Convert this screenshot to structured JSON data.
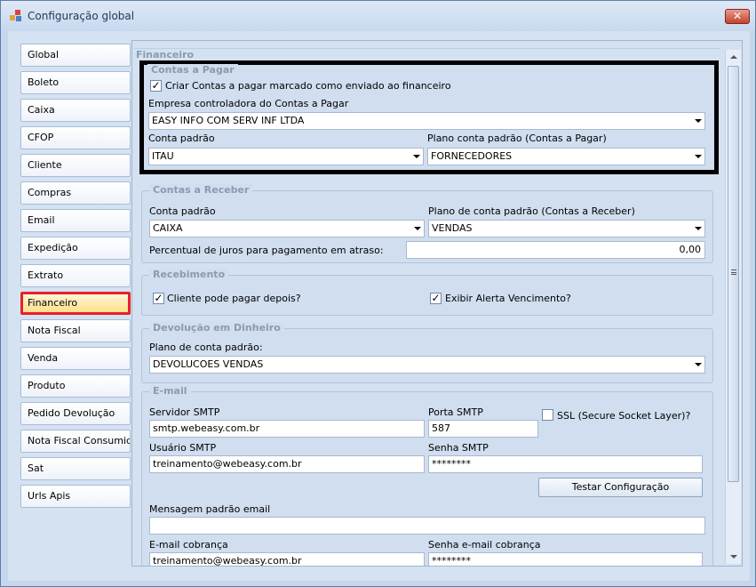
{
  "window": {
    "title": "Configuração global",
    "close_glyph": "✕"
  },
  "nav": {
    "items": [
      {
        "label": "Global"
      },
      {
        "label": "Boleto"
      },
      {
        "label": "Caixa"
      },
      {
        "label": "CFOP"
      },
      {
        "label": "Cliente"
      },
      {
        "label": "Compras"
      },
      {
        "label": "Email"
      },
      {
        "label": "Expedição"
      },
      {
        "label": "Extrato"
      },
      {
        "label": "Financeiro"
      },
      {
        "label": "Nota Fiscal"
      },
      {
        "label": "Venda"
      },
      {
        "label": "Produto"
      },
      {
        "label": "Pedido Devolução"
      },
      {
        "label": "Nota Fiscal Consumidor"
      },
      {
        "label": "Sat"
      },
      {
        "label": "Urls Apis"
      }
    ],
    "active": "Financeiro"
  },
  "pane": {
    "header": "Financeiro"
  },
  "contas_pagar": {
    "title": "Contas a Pagar",
    "criar_label": "Criar Contas a pagar marcado como enviado ao financeiro",
    "criar_checked": true,
    "empresa_label": "Empresa controladora do Contas a Pagar",
    "empresa_value": "EASY INFO COM  SERV INF LTDA",
    "conta_label": "Conta padrão",
    "conta_value": "ITAU",
    "plano_label": "Plano conta padrão (Contas a Pagar)",
    "plano_value": "FORNECEDORES"
  },
  "contas_receber": {
    "title": "Contas a Receber",
    "conta_label": "Conta padrão",
    "conta_value": "CAIXA",
    "plano_label": "Plano de conta padrão (Contas a Receber)",
    "plano_value": "VENDAS",
    "juros_label": "Percentual de juros para pagamento em atraso:",
    "juros_value": "0,00"
  },
  "recebimento": {
    "title": "Recebimento",
    "cliente_label": "Cliente pode pagar depois?",
    "cliente_checked": true,
    "alerta_label": "Exibir Alerta Vencimento?",
    "alerta_checked": true
  },
  "devolucao": {
    "title": "Devolução em Dinheiro",
    "plano_label": "Plano de conta padrão:",
    "plano_value": "DEVOLUCOES VENDAS"
  },
  "email": {
    "title": "E-mail",
    "servidor_label": "Servidor SMTP",
    "servidor_value": "smtp.webeasy.com.br",
    "porta_label": "Porta SMTP",
    "porta_value": "587",
    "ssl_label": "SSL (Secure Socket Layer)?",
    "ssl_checked": false,
    "usuario_label": "Usuário SMTP",
    "usuario_value": "treinamento@webeasy.com.br",
    "senha_label": "Senha SMTP",
    "senha_value": "********",
    "testar_label": "Testar Configuração",
    "mensagem_label": "Mensagem padrão email",
    "mensagem_value": "",
    "cobranca_label": "E-mail cobrança",
    "cobranca_value": "treinamento@webeasy.com.br",
    "senha_cobranca_label": "Senha e-mail cobrança",
    "senha_cobranca_value": "********"
  },
  "icons": {
    "check": "✓"
  }
}
